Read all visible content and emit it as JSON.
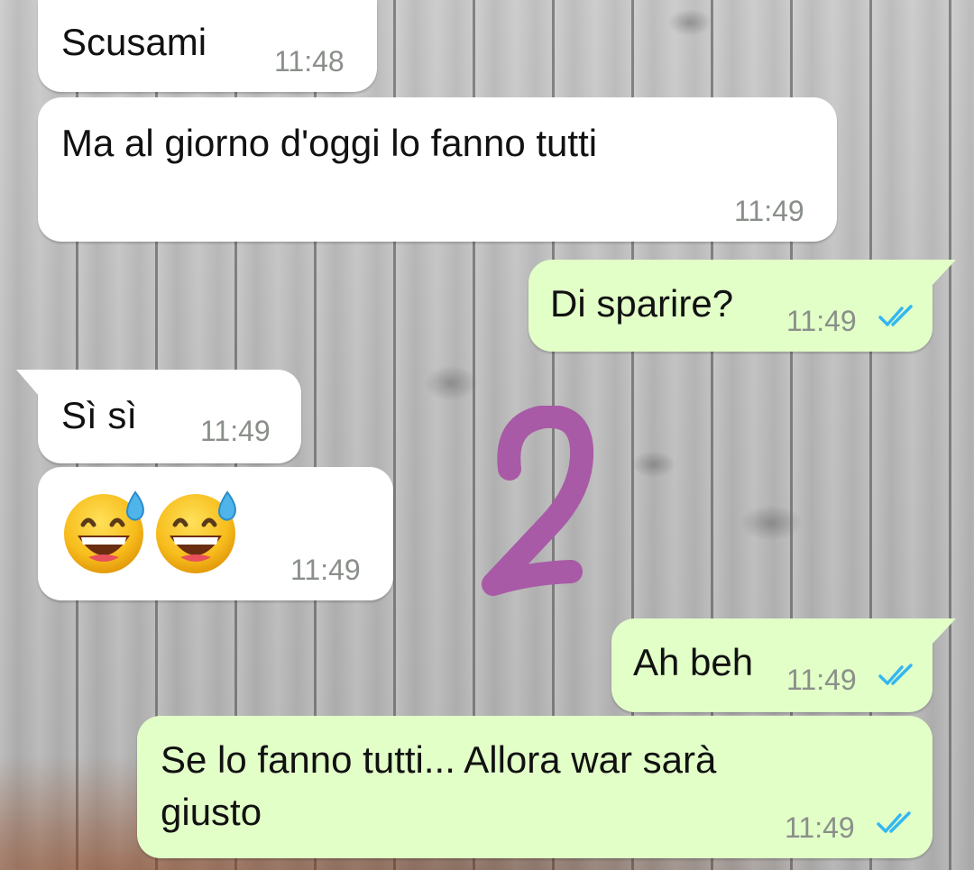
{
  "messages": [
    {
      "direction": "in",
      "text": "Scusami",
      "time": "11:48"
    },
    {
      "direction": "in",
      "text": "Ma al giorno d'oggi lo fanno tutti",
      "time": "11:49"
    },
    {
      "direction": "out",
      "text": "Di sparire?",
      "time": "11:49",
      "status": "read-double-check-icon"
    },
    {
      "direction": "in",
      "text": "Sì sì",
      "time": "11:49"
    },
    {
      "direction": "in",
      "emoji": [
        "grinning-face-with-sweat-emoji",
        "grinning-face-with-sweat-emoji"
      ],
      "time": "11:49"
    },
    {
      "direction": "out",
      "text": "Ah beh",
      "time": "11:49",
      "status": "read-double-check-icon"
    },
    {
      "direction": "out",
      "text_lines": [
        "Se lo fanno tutti... Allora war sarà",
        "giusto"
      ],
      "time": "11:49",
      "status": "read-double-check-icon"
    }
  ],
  "overlay": {
    "text": "2",
    "color": "#a85aa6"
  },
  "colors": {
    "incoming_bubble": "#ffffff",
    "outgoing_bubble": "#e2ffc8",
    "read_tick": "#34b7f1",
    "time_text": "#8a8f8a"
  }
}
